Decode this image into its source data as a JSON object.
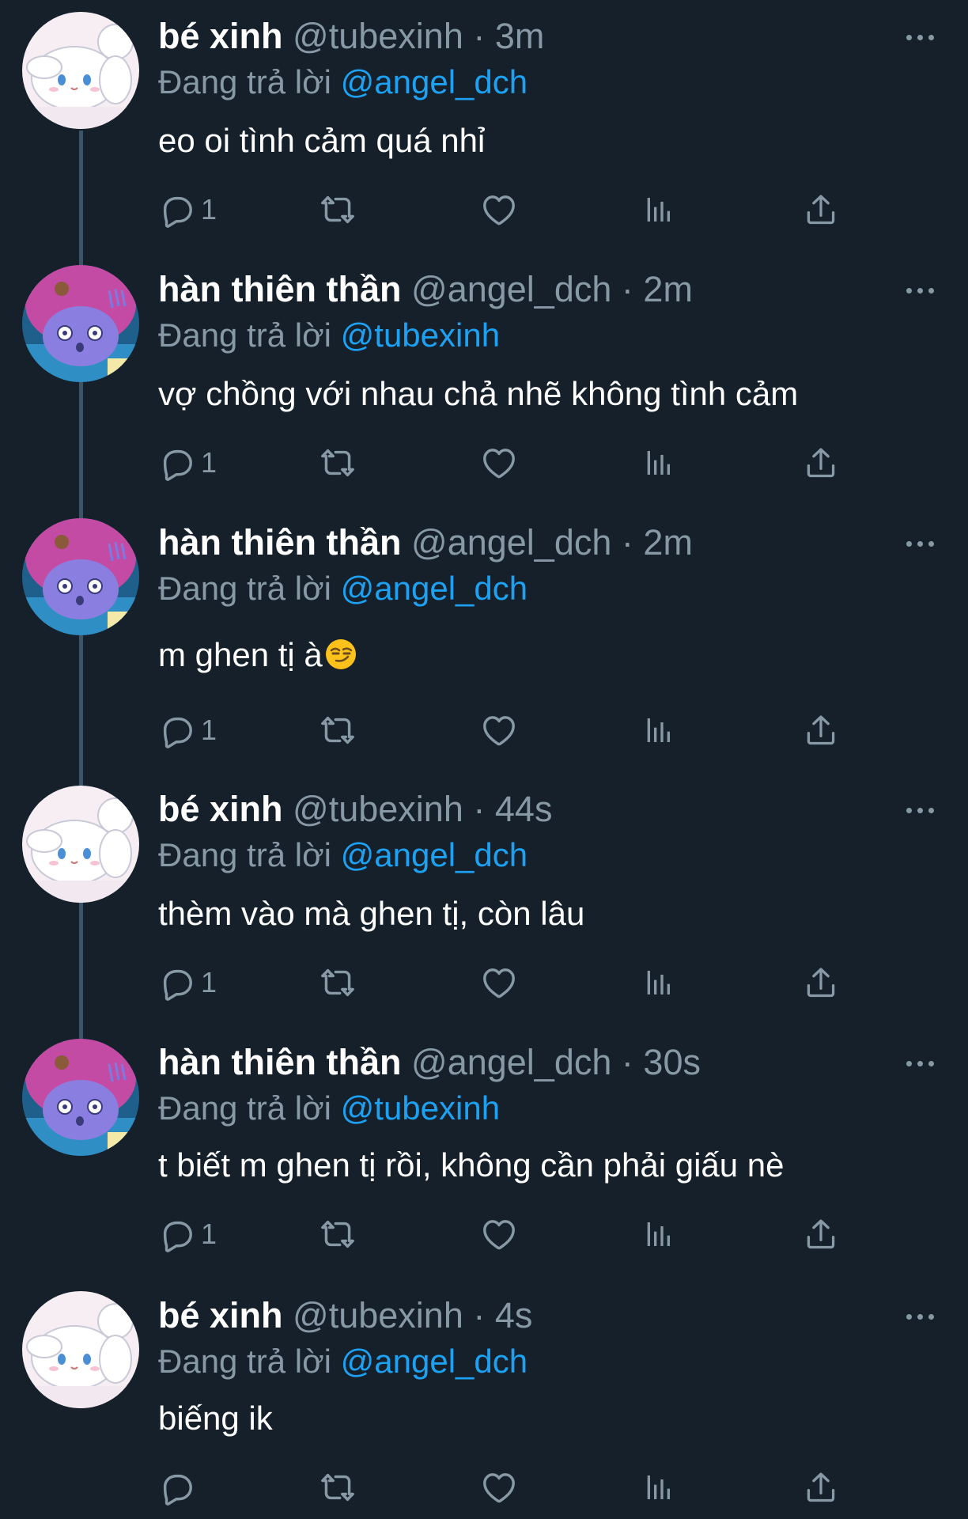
{
  "thread": {
    "tweets": [
      {
        "name": "bé xinh",
        "handle": "@tubexinh",
        "separator": "·",
        "time": "3m",
        "reply_prefix": "Đang trả lời",
        "reply_to": "@angel_dch",
        "text": "eo oi tình cảm quá nhỉ",
        "reply_count": "1",
        "avatar": "cinnamoroll-avatar"
      },
      {
        "name": "hàn thiên thần",
        "handle": "@angel_dch",
        "separator": "·",
        "time": "2m",
        "reply_prefix": "Đang trả lời",
        "reply_to": "@tubexinh",
        "text": "vợ chồng với nhau chả nhẽ không tình cảm",
        "reply_count": "1",
        "avatar": "purple-character-avatar"
      },
      {
        "name": "hàn thiên thần",
        "handle": "@angel_dch",
        "separator": "·",
        "time": "2m",
        "reply_prefix": "Đang trả lời",
        "reply_to": "@angel_dch",
        "text": "m ghen tị à",
        "emoji": "smirking-face-emoji",
        "reply_count": "1",
        "avatar": "purple-character-avatar"
      },
      {
        "name": "bé xinh",
        "handle": "@tubexinh",
        "separator": "·",
        "time": "44s",
        "reply_prefix": "Đang trả lời",
        "reply_to": "@angel_dch",
        "text": "thèm vào mà ghen tị, còn lâu",
        "reply_count": "1",
        "avatar": "cinnamoroll-avatar"
      },
      {
        "name": "hàn thiên thần",
        "handle": "@angel_dch",
        "separator": "·",
        "time": "30s",
        "reply_prefix": "Đang trả lời",
        "reply_to": "@tubexinh",
        "text": "t biết m ghen tị rồi, không cần phải giấu nè",
        "reply_count": "1",
        "avatar": "purple-character-avatar"
      },
      {
        "name": "bé xinh",
        "handle": "@tubexinh",
        "separator": "·",
        "time": "4s",
        "reply_prefix": "Đang trả lời",
        "reply_to": "@angel_dch",
        "text": "biếng ik",
        "reply_count": "",
        "avatar": "cinnamoroll-avatar"
      }
    ]
  },
  "icons": {
    "reply": "reply-icon",
    "retweet": "retweet-icon",
    "like": "heart-icon",
    "views": "analytics-icon",
    "share": "share-icon",
    "more": "more-icon"
  },
  "colors": {
    "background": "#15202b",
    "text_primary": "#ffffff",
    "text_secondary": "#8899a6",
    "mention": "#1da1f2",
    "thread_line": "#3d5466"
  }
}
